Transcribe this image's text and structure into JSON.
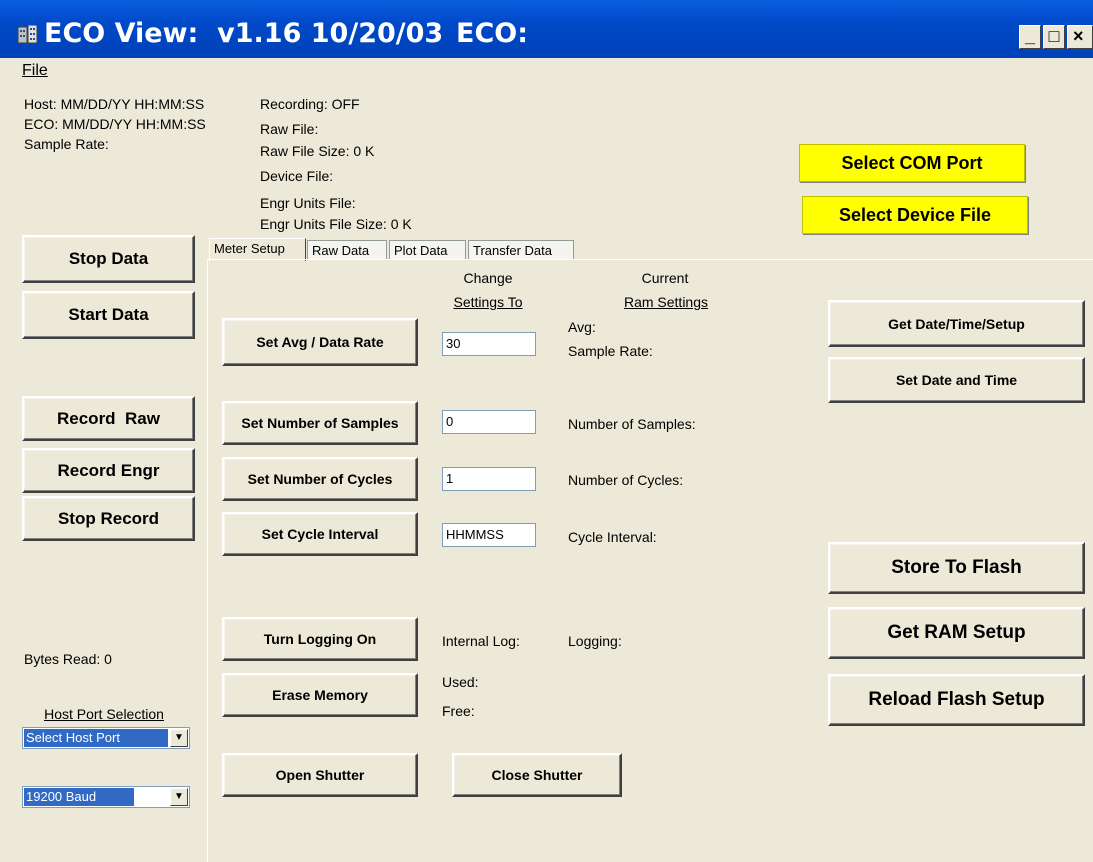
{
  "window": {
    "title": "ECO View:  v1.16 10/20/03",
    "title_eco": "ECO:",
    "minimize_glyph": "_",
    "maximize_glyph": "□",
    "close_glyph": "×",
    "titlebar_color": "#0054e3",
    "app_icon": "building-icon"
  },
  "menu": {
    "file_label": "File"
  },
  "status": {
    "host_time": "Host: MM/DD/YY HH:MM:SS",
    "eco_time": "ECO: MM/DD/YY HH:MM:SS",
    "sample_rate": "Sample Rate:",
    "recording": "Recording: OFF",
    "raw_file": "Raw File:",
    "raw_file_size": "Raw File Size: 0 K",
    "device_file": "Device File:",
    "engr_units_file": "Engr Units File:",
    "engr_units_file_size": "Engr Units File Size: 0 K"
  },
  "top_buttons": {
    "select_com_port": "Select COM Port",
    "select_device_file": "Select Device File",
    "highlight_color": "#ffff00"
  },
  "left_panel": {
    "stop_data": "Stop Data",
    "start_data": "Start Data",
    "record_raw": "Record  Raw",
    "record_engr": "Record Engr",
    "stop_record": "Stop Record",
    "bytes_read": "Bytes Read: 0",
    "host_port_label": "Host Port Selection",
    "host_port_value": "Select Host Port",
    "baud_value": "19200 Baud"
  },
  "tabs": [
    {
      "label": "Meter Setup"
    },
    {
      "label": "Raw Data"
    },
    {
      "label": "Plot Data"
    },
    {
      "label": "Transfer Data"
    }
  ],
  "meter_setup": {
    "change_header_1": "Change",
    "change_header_2": "Settings To",
    "current_header_1": "Current",
    "current_header_2": "Ram Settings",
    "set_avg_button": "Set Avg / Data Rate",
    "avg_input": "30",
    "avg_label": "Avg:",
    "sample_rate_label": "Sample Rate:",
    "set_samples_button": "Set Number of Samples",
    "samples_input": "0",
    "samples_label": "Number of Samples:",
    "set_cycles_button": "Set Number of Cycles",
    "cycles_input": "1",
    "cycles_label": "Number of Cycles:",
    "set_interval_button": "Set Cycle Interval",
    "interval_input": "HHMMSS",
    "interval_label": "Cycle Interval:",
    "logging_button": "Turn Logging On",
    "internal_log_label": "Internal Log:",
    "logging_label": "Logging:",
    "erase_button": "Erase Memory",
    "used_label": "Used:",
    "free_label": "Free:",
    "open_shutter": "Open Shutter",
    "close_shutter": "Close Shutter",
    "get_date_setup": "Get Date/Time/Setup",
    "set_date_time": "Set Date and Time",
    "store_flash": "Store To Flash",
    "get_ram_setup": "Get RAM Setup",
    "reload_flash": "Reload Flash Setup"
  }
}
